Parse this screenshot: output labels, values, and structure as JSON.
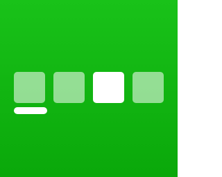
{
  "icon": {
    "description_name": "tiles-progress-app-icon",
    "background_top": "#19c219",
    "background_bottom": "#0aa80a"
  },
  "tiles": {
    "selected_index": 2,
    "items": [
      {
        "fill": "rgba(255,255,255,0.55)"
      },
      {
        "fill": "rgba(255,255,255,0.55)"
      },
      {
        "fill": "#ffffff"
      },
      {
        "fill": "rgba(255,255,255,0.55)"
      }
    ]
  },
  "indicator": {
    "color": "#ffffff",
    "under_tile_index": 0
  }
}
